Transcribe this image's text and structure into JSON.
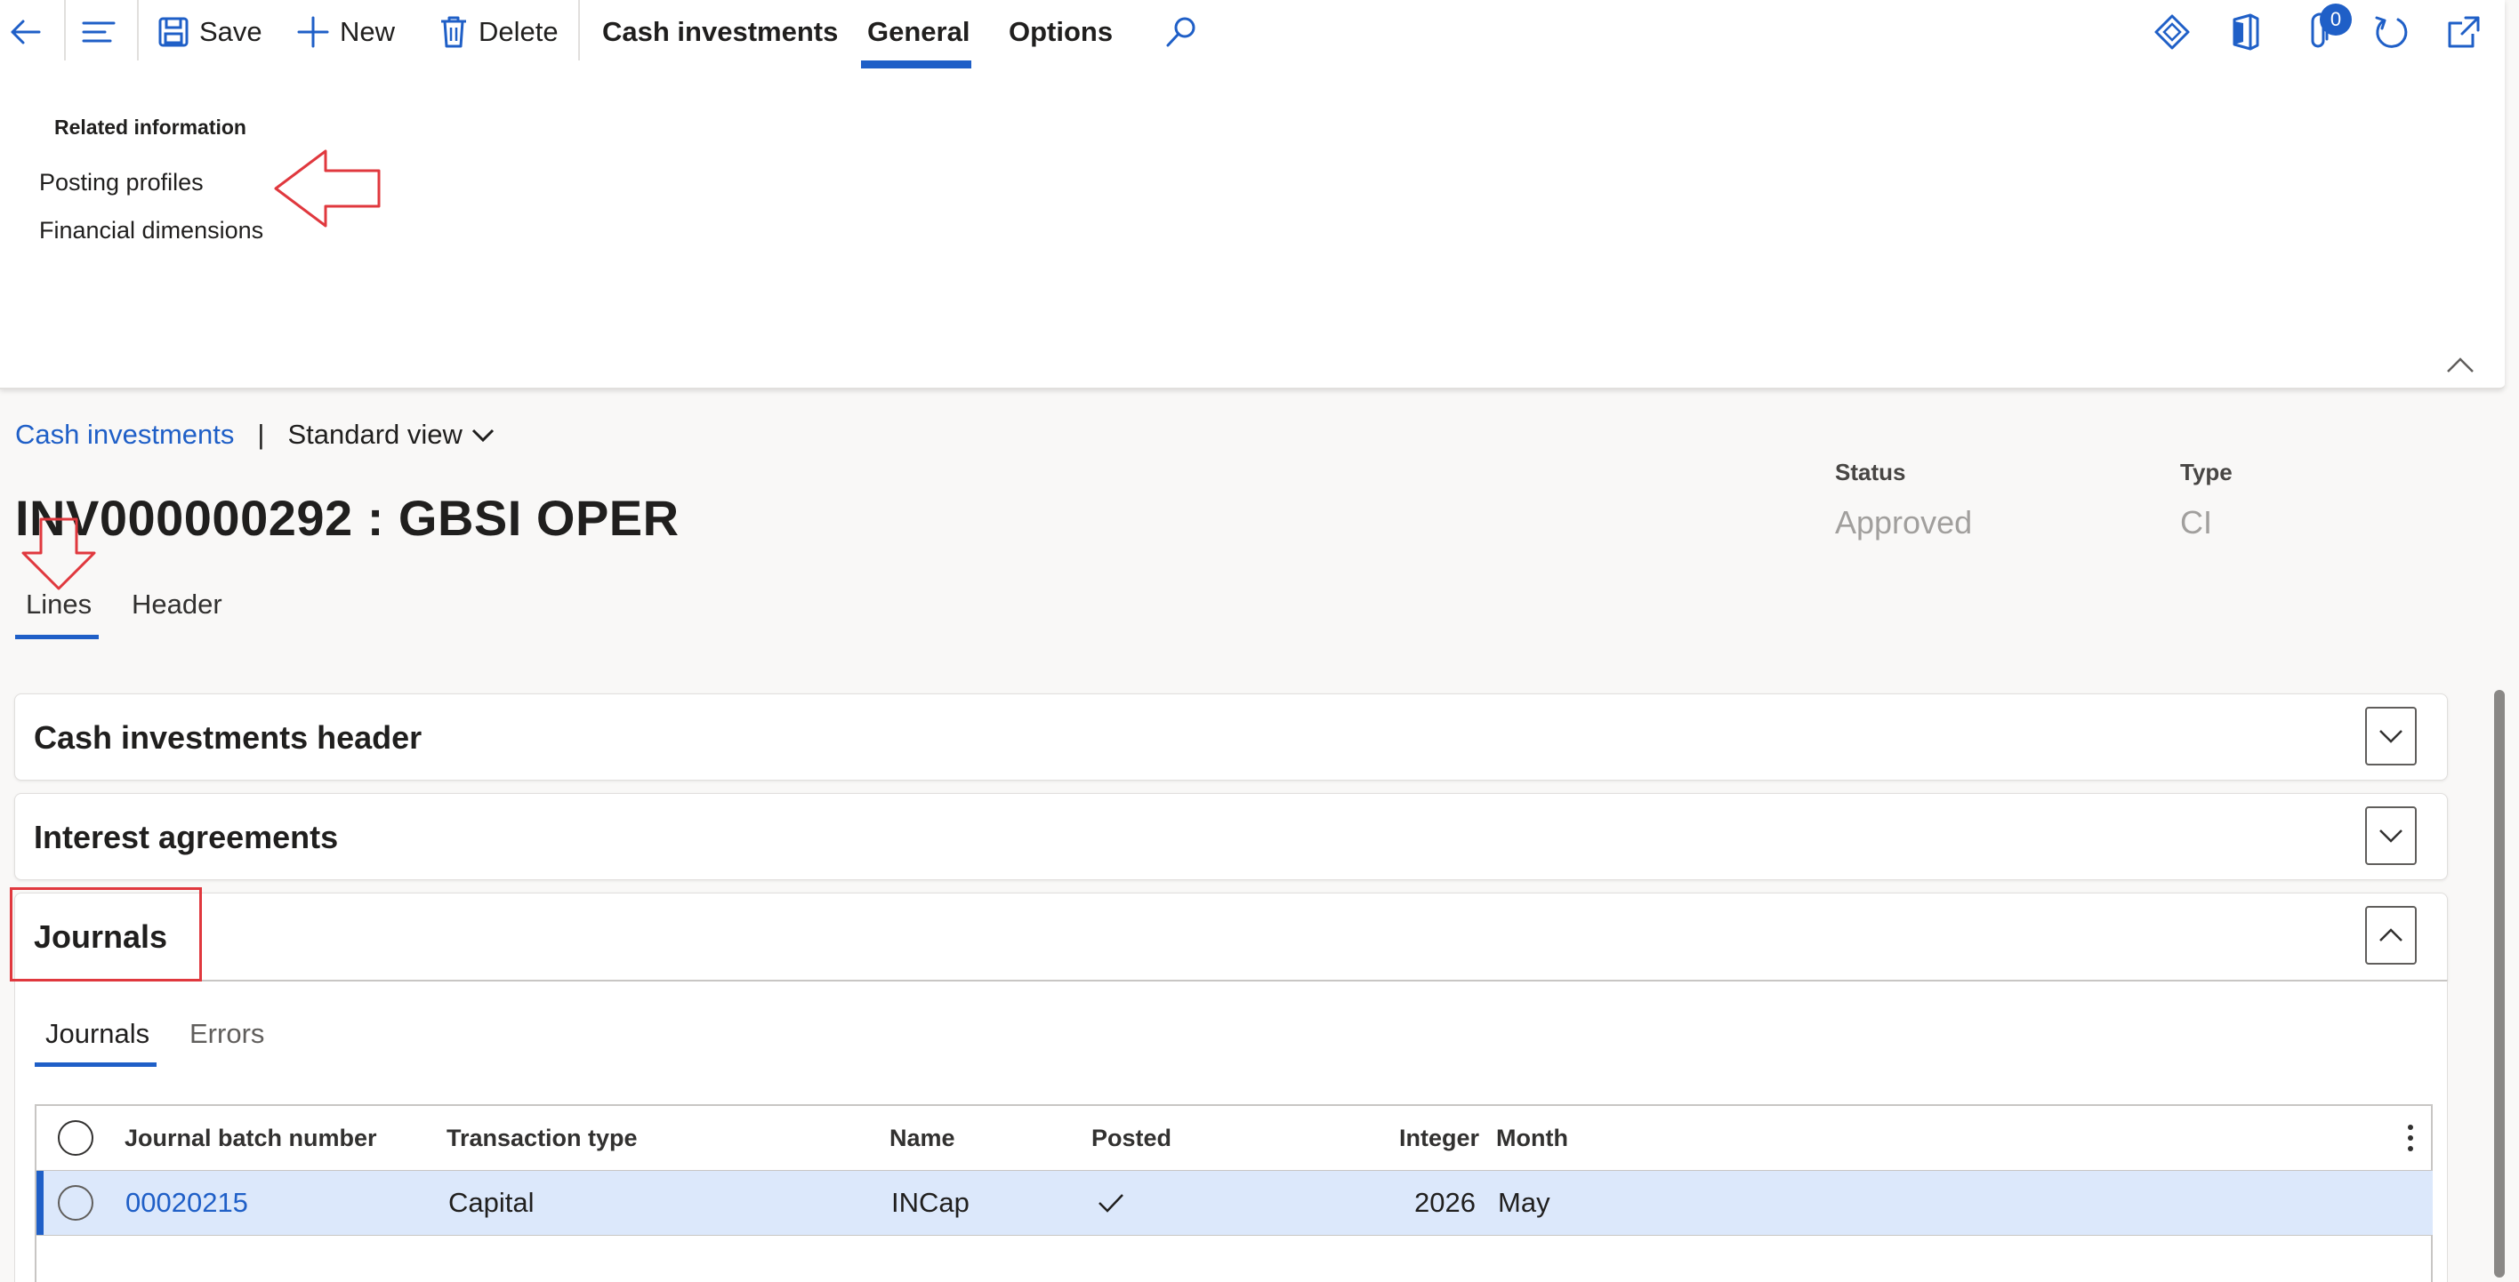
{
  "toolbar": {
    "save_label": "Save",
    "new_label": "New",
    "delete_label": "Delete",
    "tabs": [
      "Cash investments",
      "General",
      "Options"
    ],
    "active_tab": "General",
    "attachments_count": "0"
  },
  "related": {
    "title": "Related information",
    "links": [
      "Posting profiles",
      "Financial dimensions"
    ]
  },
  "breadcrumb": {
    "link": "Cash investments",
    "separator": "|",
    "view": "Standard view"
  },
  "record": {
    "title": "INV000000292 : GBSI OPER",
    "status_label": "Status",
    "status_value": "Approved",
    "type_label": "Type",
    "type_value": "CI"
  },
  "page_tabs": [
    "Lines",
    "Header"
  ],
  "fasttabs": {
    "header_title": "Cash investments header",
    "interest_title": "Interest agreements",
    "journals_title": "Journals"
  },
  "subtabs": [
    "Journals",
    "Errors"
  ],
  "grid": {
    "columns": [
      "Journal batch number",
      "Transaction type",
      "Name",
      "Posted",
      "Integer",
      "Month"
    ],
    "rows": [
      {
        "batch": "00020215",
        "transaction_type": "Capital",
        "name": "INCap",
        "posted": true,
        "integer": "2026",
        "month": "May"
      }
    ]
  },
  "colors": {
    "accent": "#1f5fc7",
    "selected_row": "#dce8fb",
    "annotation": "#e0383e"
  }
}
